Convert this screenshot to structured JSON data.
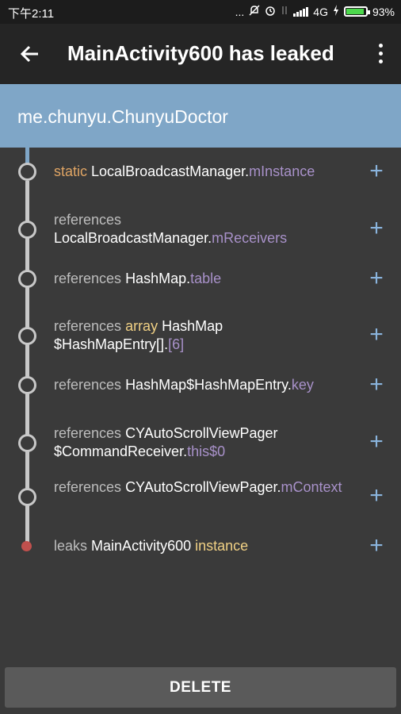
{
  "status": {
    "time": "下午2:11",
    "ellipsis": "...",
    "network": "4G",
    "battery_percent": "93%",
    "battery_level": 0.93
  },
  "appbar": {
    "title": "MainActivity600 has leaked"
  },
  "package": "me.chunyu.ChunyuDoctor",
  "trace": [
    {
      "prefix": "",
      "keyword": "static",
      "class1": "LocalBroadcastManager",
      "class2": "",
      "dot": ".",
      "field": "mInstance"
    },
    {
      "prefix": "references",
      "keyword": "",
      "class1": "LocalBroadcastManager",
      "class2": "",
      "dot": ".",
      "field": "mReceivers"
    },
    {
      "prefix": "references",
      "keyword": "",
      "class1": "HashMap",
      "class2": "",
      "dot": ".",
      "field": "table"
    },
    {
      "prefix": "references",
      "keyword": "array",
      "class1": "HashMap",
      "class2": "$HashMapEntry[]",
      "dot": ".",
      "field": "[6]"
    },
    {
      "prefix": "references",
      "keyword": "",
      "class1": "HashMap$HashMapEntry",
      "class2": "",
      "dot": ".",
      "field": "key"
    },
    {
      "prefix": "references",
      "keyword": "",
      "class1": "CYAutoScrollViewPager",
      "class2": "$CommandReceiver",
      "dot": ".",
      "field": "this$0"
    },
    {
      "prefix": "references",
      "keyword": "",
      "class1": "CYAutoScrollViewPager",
      "class2": "",
      "dot": ".",
      "field": "mContext"
    },
    {
      "prefix": "leaks",
      "keyword": "",
      "class1": "MainActivity600",
      "class2": "",
      "dot": "",
      "field": "instance"
    }
  ],
  "expand_symbol": "+",
  "delete_label": "DELETE",
  "colors": {
    "header": "#7fa6c7",
    "background": "#3a3a3a",
    "field": "#a891c9",
    "keyword": "#e0a564",
    "leak_dot": "#c0504d"
  }
}
